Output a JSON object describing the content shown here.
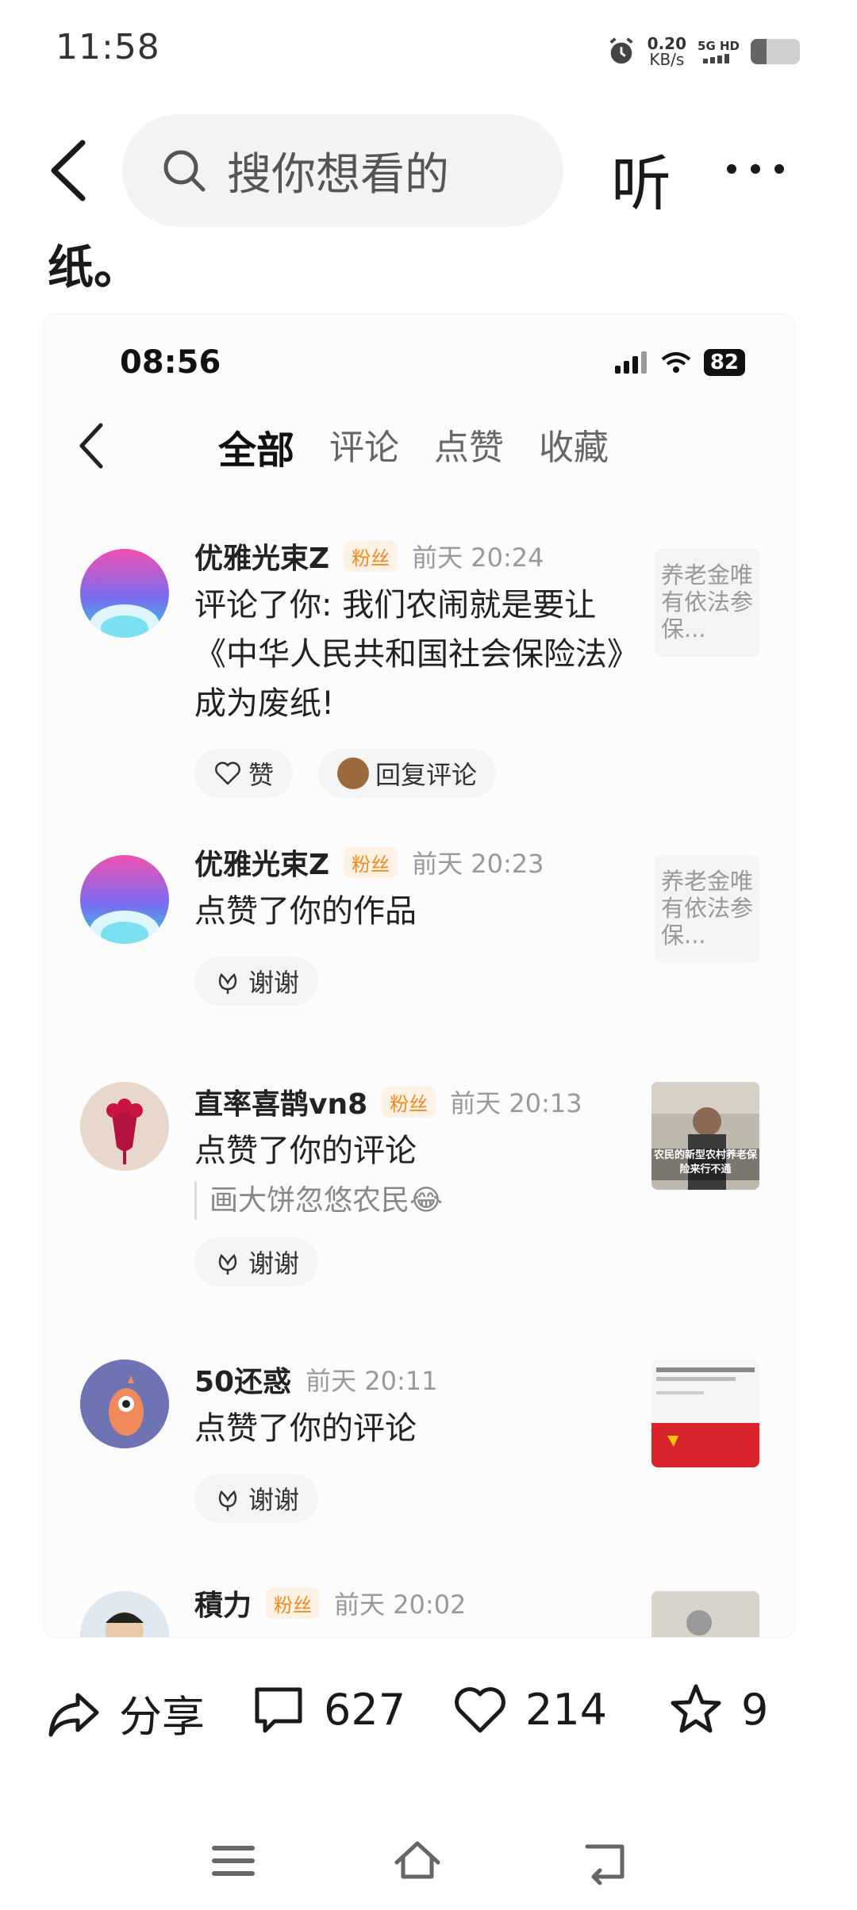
{
  "status_bar": {
    "time": "11:58",
    "net_speed_value": "0.20",
    "net_speed_unit": "KB/s",
    "signal_labels": "5G HD",
    "icons": [
      "alarm-icon",
      "signal-icon",
      "battery-icon"
    ]
  },
  "top_bar": {
    "search_placeholder": "搜你想看的",
    "listen_label": "听",
    "icons": [
      "back-icon",
      "search-icon",
      "more-icon"
    ]
  },
  "article_tail": "纸。",
  "screenshot": {
    "time": "08:56",
    "battery": "82",
    "tabs": [
      {
        "label": "全部",
        "active": true
      },
      {
        "label": "评论",
        "active": false
      },
      {
        "label": "点赞",
        "active": false
      },
      {
        "label": "收藏",
        "active": false
      }
    ],
    "notifications": [
      {
        "name": "优雅光束Z",
        "badge": "粉丝",
        "time": "前天 20:24",
        "text": "评论了你: 我们农闹就是要让《中华人民共和国社会保险法》成为废纸!",
        "like_label": "赞",
        "reply_label": "回复评论",
        "thumb_text": "养老金唯有依法参保..."
      },
      {
        "name": "优雅光束Z",
        "badge": "粉丝",
        "time": "前天 20:23",
        "text": "点赞了你的作品",
        "thanks_label": "谢谢",
        "thumb_text": "养老金唯有依法参保..."
      },
      {
        "name": "直率喜鹊vn8",
        "badge": "粉丝",
        "time": "前天 20:13",
        "text": "点赞了你的评论",
        "quote": "画大饼忽悠农民",
        "quote_emoji": "😂",
        "thanks_label": "谢谢",
        "thumb_caption": "农民的新型农村养老保险来行不通"
      },
      {
        "name": "50还惑",
        "badge": "",
        "time": "前天 20:11",
        "text": "点赞了你的评论",
        "thanks_label": "谢谢"
      },
      {
        "name": "積力",
        "badge": "粉丝",
        "time": "前天 20:02"
      }
    ]
  },
  "bottom_bar": {
    "share_label": "分享",
    "comment_count": "627",
    "like_count": "214",
    "favorite_count": "9"
  },
  "colors": {
    "fan_badge": "#f08a1c",
    "search_bg": "#f2f3f5"
  }
}
